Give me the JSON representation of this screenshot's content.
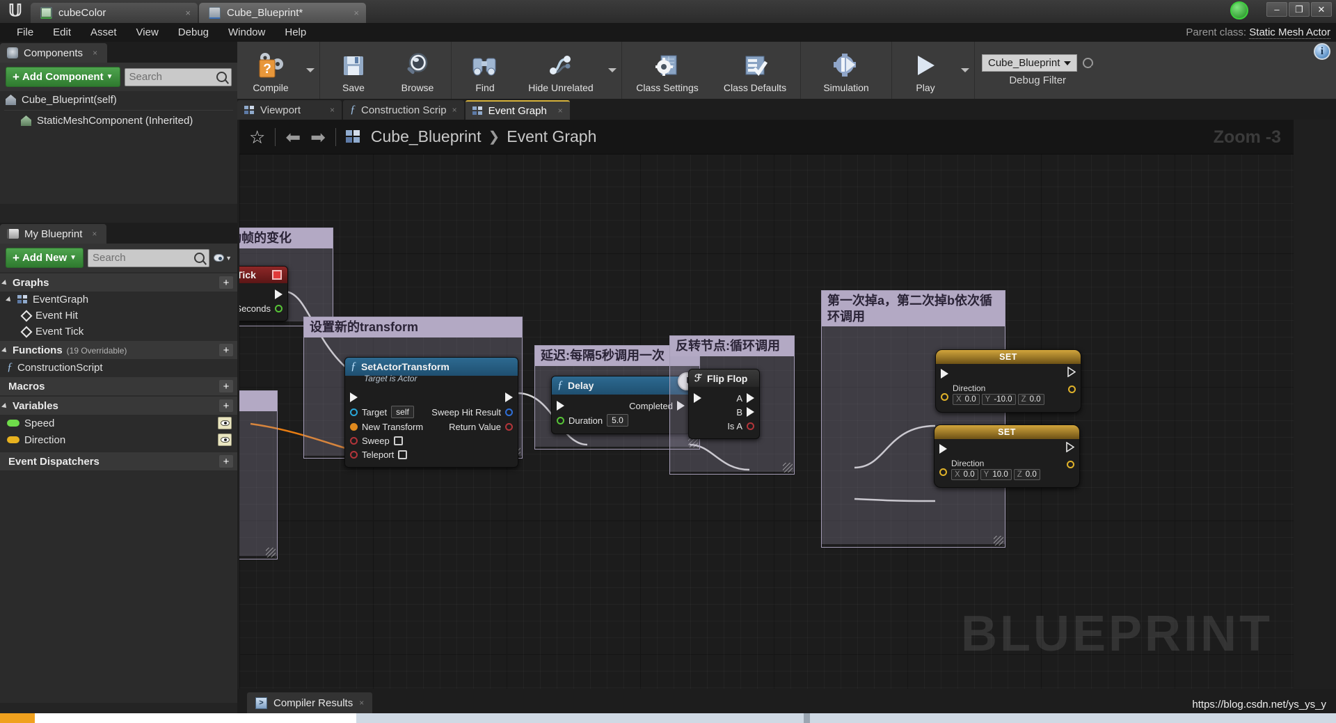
{
  "window": {
    "tabs": [
      {
        "label": "cubeColor",
        "icon": "grid-asset-icon",
        "active": false,
        "close": "×"
      },
      {
        "label": "Cube_Blueprint*",
        "icon": "blueprint-house-icon",
        "active": true,
        "close": "×"
      }
    ],
    "controls": {
      "minimize": "–",
      "restore": "❐",
      "close": "✕"
    },
    "logo": "unreal-engine-logo"
  },
  "menubar": {
    "items": [
      "File",
      "Edit",
      "Asset",
      "View",
      "Debug",
      "Window",
      "Help"
    ],
    "parent_class_label": "Parent class:",
    "parent_class_value": "Static Mesh Actor"
  },
  "components_panel": {
    "tab_label": "Components",
    "tab_close": "×",
    "add_button": "Add Component",
    "add_plus": "+",
    "search_placeholder": "Search",
    "items": [
      {
        "label": "Cube_Blueprint(self)",
        "icon": "house-icon",
        "indent": 0
      },
      {
        "label": "StaticMeshComponent (Inherited)",
        "icon": "house-icon",
        "indent": 1
      }
    ]
  },
  "my_blueprint_panel": {
    "tab_label": "My Blueprint",
    "tab_close": "×",
    "add_button": "Add New",
    "add_plus": "+",
    "search_placeholder": "Search",
    "sections": [
      {
        "title": "Graphs",
        "note": "",
        "plus": "+"
      },
      {
        "title": "Functions",
        "note": "(19 Overridable)",
        "plus": "+"
      },
      {
        "title": "Macros",
        "note": "",
        "plus": "+"
      },
      {
        "title": "Variables",
        "note": "",
        "plus": "+"
      },
      {
        "title": "Event Dispatchers",
        "note": "",
        "plus": "+"
      }
    ],
    "graphs": [
      {
        "label": "EventGraph",
        "icon": "graph-icon"
      },
      {
        "label": "Event Hit",
        "icon": "event-diamond-icon"
      },
      {
        "label": "Event Tick",
        "icon": "event-diamond-icon"
      }
    ],
    "functions": [
      {
        "label": "ConstructionScript",
        "icon": "function-icon"
      }
    ],
    "variables": [
      {
        "label": "Speed",
        "color": "#6fdd4a",
        "eye": "visible-eye-icon"
      },
      {
        "label": "Direction",
        "color": "#e8b21f",
        "eye": "visible-eye-icon"
      }
    ]
  },
  "toolbar": {
    "groups": [
      {
        "items": [
          {
            "label": "Compile",
            "icon": "compile-question-icon",
            "caret": true
          }
        ]
      },
      {
        "items": [
          {
            "label": "Save",
            "icon": "save-floppy-icon"
          },
          {
            "label": "Browse",
            "icon": "browse-magnifier-icon"
          }
        ]
      },
      {
        "items": [
          {
            "label": "Find",
            "icon": "find-binoculars-icon"
          },
          {
            "label": "Hide Unrelated",
            "icon": "hide-unrelated-icon",
            "caret": true
          }
        ]
      },
      {
        "items": [
          {
            "label": "Class Settings",
            "icon": "class-settings-icon"
          },
          {
            "label": "Class Defaults",
            "icon": "class-defaults-icon"
          }
        ]
      },
      {
        "items": [
          {
            "label": "Simulation",
            "icon": "simulation-icon"
          }
        ]
      },
      {
        "items": [
          {
            "label": "Play",
            "icon": "play-icon",
            "caret": true
          }
        ]
      }
    ],
    "debug_filter_value": "Cube_Blueprint",
    "debug_filter_label": "Debug Filter",
    "debug_search_icon": "search-icon",
    "info_icon": "info-icon"
  },
  "graph_tabs": [
    {
      "label": "Viewport",
      "icon": "viewport-icon",
      "active": false,
      "close": "×"
    },
    {
      "label": "Construction Scrip",
      "icon": "function-icon",
      "active": false,
      "close": "×"
    },
    {
      "label": "Event Graph",
      "icon": "graph-icon",
      "active": true,
      "close": "×"
    }
  ],
  "graph_header": {
    "star": "☆",
    "back": "⬅",
    "forward": "➡",
    "breadcrumb_icon": "graph-icon",
    "breadcrumb_root": "Cube_Blueprint",
    "breadcrumb_chevron": "❯",
    "breadcrumb_leaf": "Event Graph",
    "zoom_label": "Zoom -3"
  },
  "graph": {
    "watermark": "BLUEPRINT",
    "comments": [
      {
        "name": "comment-event-tick",
        "text": "于驱动帧的变化"
      },
      {
        "name": "comment-set-transform",
        "text": "设置新的transform"
      },
      {
        "name": "comment-delay",
        "text": "延迟:每隔5秒调用一次"
      },
      {
        "name": "comment-flipflop",
        "text": "反转节点:循环调用"
      },
      {
        "name": "comment-set-direction",
        "text": "第一次掉a，第二次掉b依次循环调用"
      }
    ],
    "nodes": {
      "event_tick": {
        "title": "nt Tick",
        "out_pin": "",
        "delta": "Seconds"
      },
      "set_actor_transform": {
        "title": "SetActorTransform",
        "subtitle": "Target is Actor",
        "inputs": [
          {
            "label": "Target",
            "value": "self",
            "pin": "object-pin"
          },
          {
            "label": "New Transform",
            "value": "",
            "pin": "struct-pin"
          },
          {
            "label": "Sweep",
            "value": "",
            "pin": "bool-pin"
          },
          {
            "label": "Teleport",
            "value": "",
            "pin": "bool-pin"
          }
        ],
        "outputs": [
          {
            "label": "Sweep Hit Result",
            "pin": "struct-pin"
          },
          {
            "label": "Return Value",
            "pin": "bool-pin"
          }
        ]
      },
      "delay": {
        "title": "Delay",
        "clock_icon": "clock-icon",
        "output_exec": "Completed",
        "duration_label": "Duration",
        "duration_value": "5.0"
      },
      "flip_flop": {
        "title": "Flip Flop",
        "glyph_icon": "flipflop-icon",
        "outputs": [
          {
            "label": "A",
            "type": "exec"
          },
          {
            "label": "B",
            "type": "exec"
          },
          {
            "label": "Is A",
            "type": "bool"
          }
        ]
      },
      "set_direction_a": {
        "title": "SET",
        "var_label": "Direction",
        "vector": {
          "x_label": "X",
          "x": "0.0",
          "y_label": "Y",
          "y": "-10.0",
          "z_label": "Z",
          "z": "0.0"
        }
      },
      "set_direction_b": {
        "title": "SET",
        "var_label": "Direction",
        "vector": {
          "x_label": "X",
          "x": "0.0",
          "y_label": "Y",
          "y": "10.0",
          "z_label": "Z",
          "z": "0.0"
        }
      }
    }
  },
  "bottom": {
    "compiler_tab": "Compiler Results",
    "compiler_close": "×",
    "compiler_icon": "console-icon",
    "url_stamp": "https://blog.csdn.net/ys_ys_y"
  }
}
